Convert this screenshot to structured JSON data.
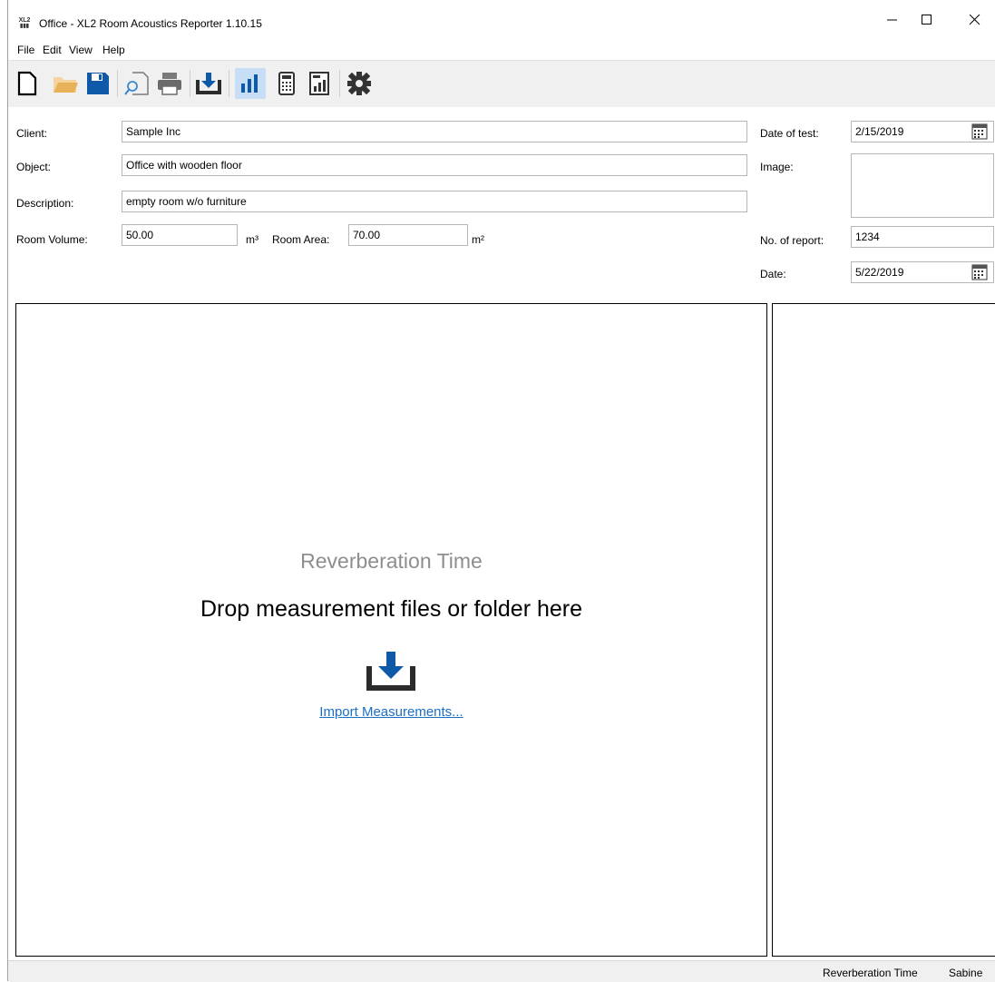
{
  "window": {
    "app_icon_label": "XL2",
    "title": "Office - XL2 Room Acoustics Reporter 1.10.15",
    "minimize_icon": "minimize-icon",
    "maximize_icon": "maximize-icon",
    "close_icon": "close-icon"
  },
  "menu": {
    "items": [
      {
        "label": "File",
        "accel": "F"
      },
      {
        "label": "Edit",
        "accel": "E"
      },
      {
        "label": "View",
        "accel": "V"
      },
      {
        "label": "Help",
        "accel": "H"
      }
    ]
  },
  "toolbar": {
    "buttons": [
      "new-document-icon",
      "open-folder-icon",
      "save-icon",
      "print-preview-icon",
      "print-icon",
      "import-icon",
      "bar-chart-icon",
      "calculator-icon",
      "report-icon",
      "settings-gear-icon"
    ],
    "active": "bar-chart-icon"
  },
  "form": {
    "client_label": "Client:",
    "client_value": "Sample Inc",
    "object_label": "Object:",
    "object_value": "Office with wooden floor",
    "description_label": "Description:",
    "description_value": "empty room w/o furniture",
    "room_volume_label": "Room Volume:",
    "room_volume_value": "50.00",
    "room_volume_unit": "m³",
    "room_area_label": "Room Area:",
    "room_area_value": "70.00",
    "room_area_unit": "m²",
    "date_of_test_label": "Date of test:",
    "date_of_test_value": "2/15/2019",
    "image_label": "Image:",
    "report_no_label": "No. of report:",
    "report_no_value": "1234",
    "date_label": "Date:",
    "date_value": "5/22/2019"
  },
  "drop_zone": {
    "title": "Reverberation Time",
    "message": "Drop measurement files or folder here",
    "icon": "import-tray-icon",
    "link": "Import Measurements..."
  },
  "status": {
    "mode": "Reverberation Time",
    "method": "Sabine"
  },
  "colors": {
    "accent_blue": "#0f5aa8",
    "toolbar_bg": "#f0f0f0",
    "active_button_bg": "#c7def7",
    "link": "#1a6fc7",
    "folder": "#e8b25a"
  }
}
